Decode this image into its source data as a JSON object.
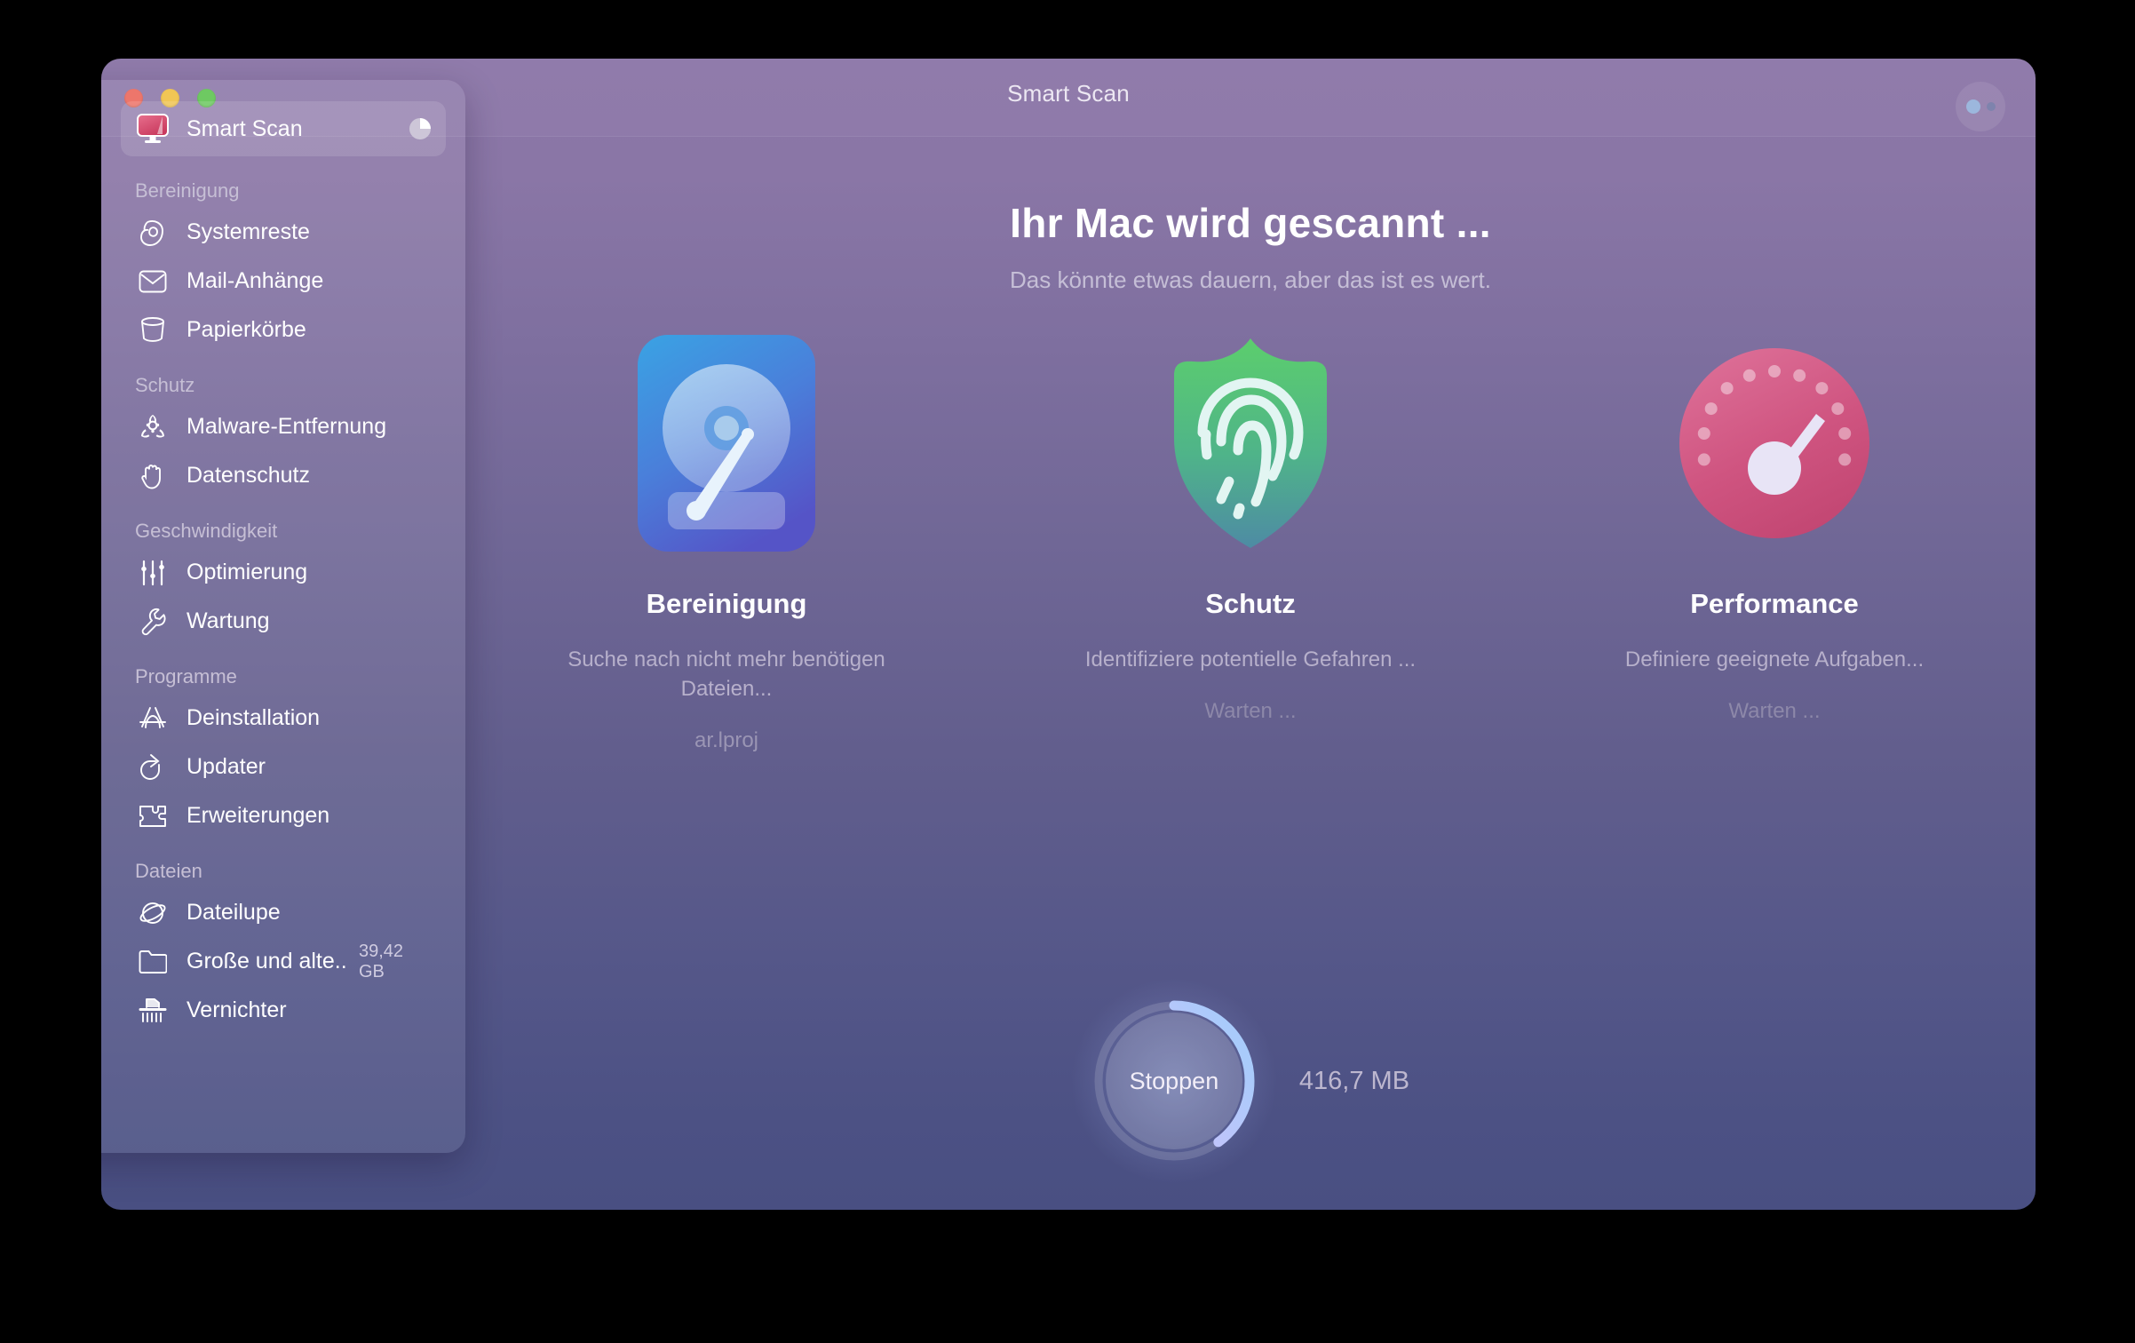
{
  "window": {
    "title": "Smart Scan",
    "traffic_lights": [
      {
        "name": "close",
        "color": "#ec6a5e"
      },
      {
        "name": "minimize",
        "color": "#f0c146"
      },
      {
        "name": "zoom",
        "color": "#61c454"
      }
    ],
    "more_button_label": ""
  },
  "sidebar": {
    "selected": {
      "label": "Smart Scan",
      "icon": "smart-scan-monitor-icon",
      "trailing_icon": "pie-chart-icon"
    },
    "groups": [
      {
        "title": "Bereinigung",
        "items": [
          {
            "label": "Systemreste",
            "icon": "system-junk-icon",
            "badge": ""
          },
          {
            "label": "Mail-Anhänge",
            "icon": "mail-icon",
            "badge": ""
          },
          {
            "label": "Papierkörbe",
            "icon": "trash-bin-icon",
            "badge": ""
          }
        ]
      },
      {
        "title": "Schutz",
        "items": [
          {
            "label": "Malware-Entfernung",
            "icon": "biohazard-icon",
            "badge": ""
          },
          {
            "label": "Datenschutz",
            "icon": "hand-icon",
            "badge": ""
          }
        ]
      },
      {
        "title": "Geschwindigkeit",
        "items": [
          {
            "label": "Optimierung",
            "icon": "sliders-icon",
            "badge": ""
          },
          {
            "label": "Wartung",
            "icon": "wrench-icon",
            "badge": ""
          }
        ]
      },
      {
        "title": "Programme",
        "items": [
          {
            "label": "Deinstallation",
            "icon": "app-store-icon",
            "badge": ""
          },
          {
            "label": "Updater",
            "icon": "update-arrow-icon",
            "badge": ""
          },
          {
            "label": "Erweiterungen",
            "icon": "puzzle-piece-icon",
            "badge": ""
          }
        ]
      },
      {
        "title": "Dateien",
        "items": [
          {
            "label": "Dateilupe",
            "icon": "space-lens-icon",
            "badge": ""
          },
          {
            "label": "Große und alte...",
            "icon": "folder-icon",
            "badge": "39,42 GB"
          },
          {
            "label": "Vernichter",
            "icon": "shredder-icon",
            "badge": ""
          }
        ]
      }
    ]
  },
  "main": {
    "heading": "Ihr Mac wird gescannt ...",
    "subheading": "Das könnte etwas dauern, aber das ist es wert.",
    "cards": [
      {
        "title": "Bereinigung",
        "description": "Suche nach nicht mehr benötigen Dateien...",
        "status": "ar.lproj",
        "icon": "hard-drive-icon",
        "active": true,
        "colors": {
          "from": "#3d9ee0",
          "to": "#5558c8"
        }
      },
      {
        "title": "Schutz",
        "description": "Identifiziere potentielle Gefahren ...",
        "status": "Warten ...",
        "icon": "shield-fingerprint-icon",
        "active": false,
        "colors": {
          "from": "#53c96a",
          "to": "#4d8fa0"
        }
      },
      {
        "title": "Performance",
        "description": "Definiere geeignete Aufgaben...",
        "status": "Warten ...",
        "icon": "speedometer-icon",
        "active": false,
        "colors": {
          "from": "#d9638e",
          "to": "#c94b77"
        }
      }
    ],
    "stop_button_label": "Stoppen",
    "scanned_size": "416,7 MB",
    "progress_percent": 40
  }
}
